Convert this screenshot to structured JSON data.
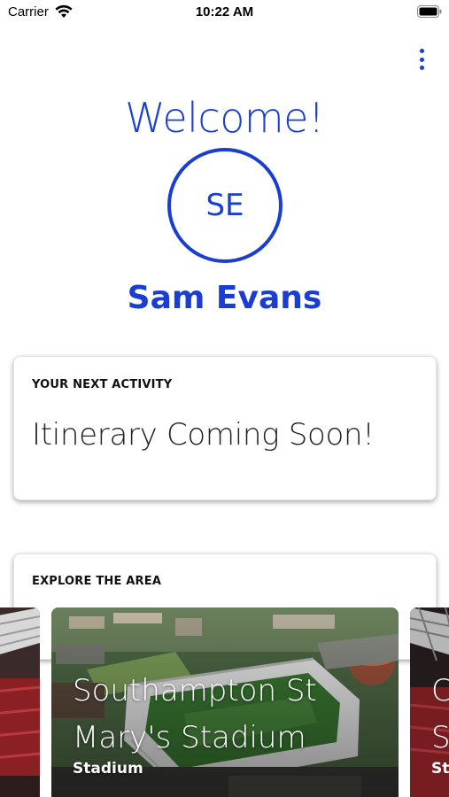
{
  "status_bar": {
    "carrier": "Carrier",
    "time": "10:22 AM"
  },
  "header": {
    "welcome": "Welcome!",
    "initials": "SE",
    "user_name": "Sam Evans"
  },
  "next_activity": {
    "heading": "YOUR NEXT ACTIVITY",
    "text": "Itinerary Coming Soon!"
  },
  "explore": {
    "heading": "EXPLORE THE AREA",
    "places": [
      {
        "title_line1": "Southampton St",
        "title_line2": "Mary's Stadium",
        "category": "Stadium"
      }
    ],
    "next_peek": {
      "title_fragment": "C",
      "title_fragment2": "S",
      "category_fragment": "St"
    }
  },
  "colors": {
    "accent": "#1a3ed1"
  },
  "icons": [
    "wifi-icon",
    "battery-icon",
    "more-vertical-icon"
  ]
}
